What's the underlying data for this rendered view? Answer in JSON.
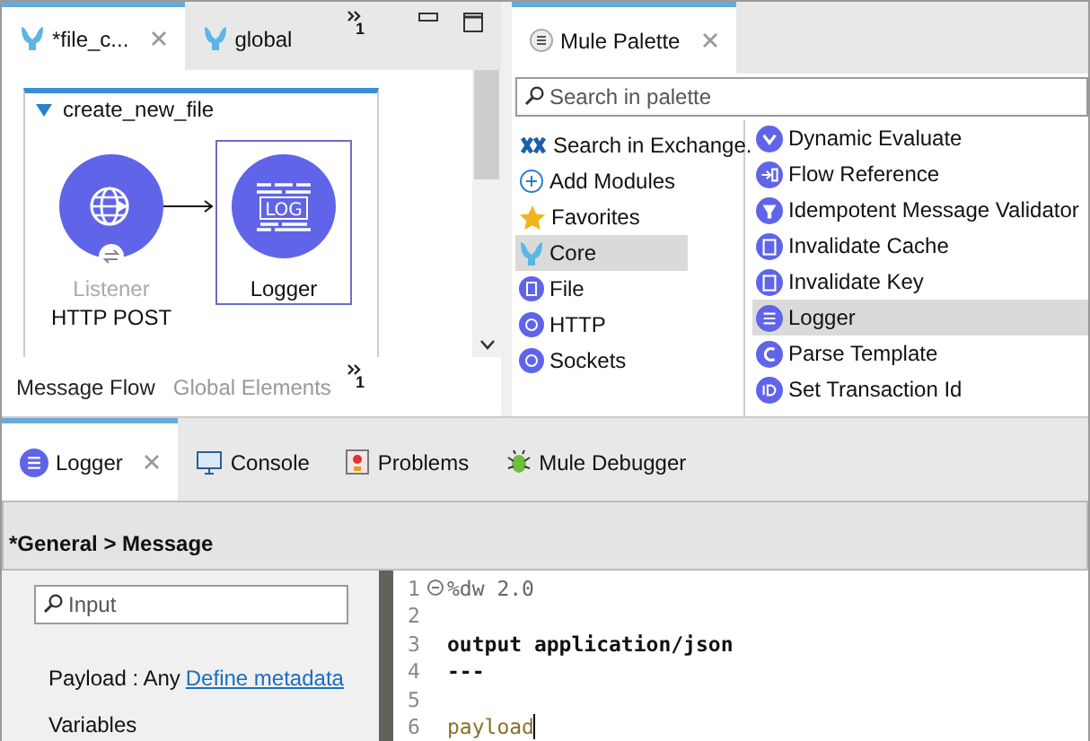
{
  "editor_tabs": [
    {
      "label": "*file_c...",
      "selected": true,
      "closable": true
    },
    {
      "label": "global",
      "selected": false
    }
  ],
  "editor_overflow": {
    "count": "1"
  },
  "flow": {
    "name": "create_new_file",
    "expanded": true,
    "nodes": [
      {
        "kind": "listener",
        "caption": "Listener",
        "label": "HTTP POST",
        "selected": false
      },
      {
        "kind": "logger",
        "icon_text": "LOG",
        "label": "Logger",
        "selected": true
      }
    ]
  },
  "flow_tabs": [
    {
      "label": "Message Flow",
      "selected": true
    },
    {
      "label": "Global Elements",
      "selected": false
    }
  ],
  "flow_tabs_overflow": {
    "count": "1"
  },
  "palette": {
    "title": "Mule Palette",
    "search": {
      "placeholder": "Search in palette"
    },
    "modules": [
      {
        "kind": "exchange",
        "label": "Search in Exchange.",
        "selected": false
      },
      {
        "kind": "add",
        "label": "Add Modules",
        "selected": false
      },
      {
        "kind": "star",
        "label": "Favorites",
        "selected": false
      },
      {
        "kind": "core",
        "label": "Core",
        "selected": true
      },
      {
        "kind": "file",
        "label": "File",
        "selected": false
      },
      {
        "kind": "globe",
        "label": "HTTP",
        "selected": false
      },
      {
        "kind": "globe",
        "label": "Sockets",
        "selected": false
      }
    ],
    "components": [
      {
        "kind": "chevron",
        "label": "Dynamic Evaluate",
        "selected": false
      },
      {
        "kind": "flowref",
        "label": "Flow Reference",
        "selected": false
      },
      {
        "kind": "filter",
        "label": "Idempotent Message Validator",
        "selected": false
      },
      {
        "kind": "clipboard",
        "label": "Invalidate Cache",
        "selected": false
      },
      {
        "kind": "clipboard",
        "label": "Invalidate Key",
        "selected": false
      },
      {
        "kind": "lines",
        "label": "Logger",
        "selected": true
      },
      {
        "kind": "template",
        "label": "Parse Template",
        "selected": false
      },
      {
        "kind": "id",
        "label": "Set Transaction Id",
        "selected": false
      }
    ]
  },
  "bottom_tabs": [
    {
      "kind": "logger",
      "label": "Logger",
      "selected": true,
      "closable": true
    },
    {
      "kind": "console",
      "label": "Console",
      "selected": false
    },
    {
      "kind": "problems",
      "label": "Problems",
      "selected": false
    },
    {
      "kind": "debugger",
      "label": "Mule Debugger",
      "selected": false
    }
  ],
  "section_title": "*General > Message",
  "input_search": {
    "placeholder": "Input"
  },
  "metadata": [
    {
      "kind": "payload",
      "label": "Payload : Any",
      "link": "Define metadata"
    },
    {
      "kind": "plain",
      "label": "Variables"
    }
  ],
  "code_lines": [
    {
      "number": "1",
      "kind": "directive",
      "text": "%dw 2.0",
      "foldable": true
    },
    {
      "number": "2"
    },
    {
      "number": "3",
      "kind": "keyword",
      "text": "output application/json"
    },
    {
      "number": "4",
      "kind": "keyword",
      "text": "---"
    },
    {
      "number": "5"
    },
    {
      "number": "6",
      "kind": "value",
      "text": "payload",
      "cursor": true
    }
  ]
}
